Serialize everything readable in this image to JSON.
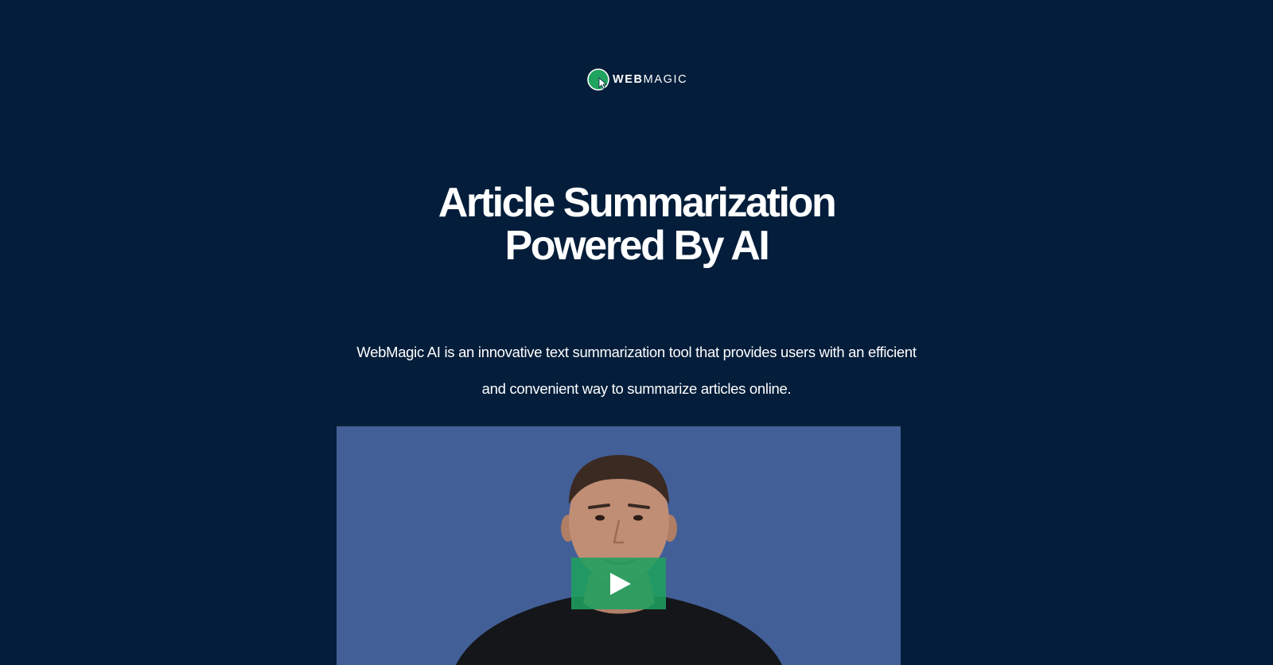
{
  "brand": {
    "logo_icon": "cursor-globe-logo-icon",
    "name_bold": "WEB",
    "name_light": "MAGIC",
    "accent_color": "#1fa35f"
  },
  "hero": {
    "title_line_1": "Article Summarization",
    "title_line_2": "Powered By AI",
    "description_line_1": "WebMagic AI is an innovative text summarization tool that provides users with an efficient",
    "description_line_2": "and convenient way to summarize articles online."
  },
  "video": {
    "play_icon": "play-icon",
    "background_color": "#435f97",
    "play_button_color": "#1ea05f"
  },
  "colors": {
    "page_background": "#031d3a",
    "text": "#ffffff"
  }
}
